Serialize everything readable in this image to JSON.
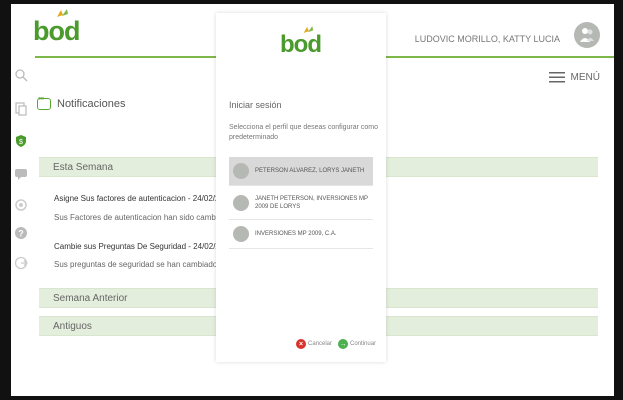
{
  "header": {
    "brand": "bod",
    "user_name": "LUDOVIC MORILLO, KATTY LUCIA",
    "menu_label": "MENÚ"
  },
  "sidebar": {
    "icons": [
      "search-icon",
      "documents-icon",
      "security-shield-icon",
      "chat-icon",
      "settings-icon",
      "help-icon",
      "logout-icon"
    ]
  },
  "notifications": {
    "title": "Notificaciones",
    "sections": {
      "this_week": "Esta Semana",
      "last_week": "Semana Anterior",
      "older": "Antiguos"
    },
    "items": [
      {
        "title": "Asigne Sus factores de autenticacion - 24/02/2016",
        "desc": "Sus Factores de autenticacion han sido cambiados satisfac"
      },
      {
        "title": "Cambie sus Preguntas De Seguridad - 24/02/2016",
        "desc": "Sus preguntas de seguridad se han cambiado satisfactoria"
      }
    ]
  },
  "modal": {
    "brand": "bod",
    "heading": "Iniciar sesión",
    "subtitle": "Selecciona el perfil que deseas configurar como predeterminado",
    "profiles": [
      "PETERSON ALVAREZ, LORYS JANETH",
      "JANETH PETERSON, INVERSIONES MP 2009 DE LORYS",
      "INVERSIONES MP 2009, C.A."
    ],
    "cancel_label": "Cancelar",
    "continue_label": "Continuar"
  },
  "colors": {
    "brand_green": "#4a9a2c",
    "section_bg": "#e4eedd",
    "info_blue": "#3a77c4",
    "cancel_red": "#d9342b",
    "continue_green": "#4caf50"
  }
}
